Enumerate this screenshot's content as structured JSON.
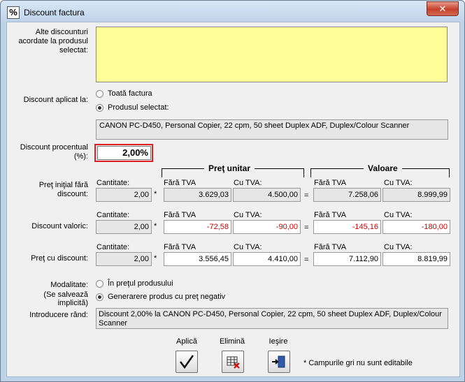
{
  "window": {
    "title": "Discount factura",
    "icon": "percent-icon"
  },
  "other_discounts": {
    "label": "Alte discounturi acordate la produsul selectat:",
    "value": ""
  },
  "apply_to": {
    "label": "Discount aplicat la:",
    "options": [
      {
        "label": "Toată factura",
        "selected": false
      },
      {
        "label": "Produsul selectat:",
        "selected": true
      }
    ],
    "product": "CANON PC-D450, Personal Copier, 22 cpm, 50 sheet Duplex ADF, Duplex/Colour Scanner"
  },
  "percent": {
    "label": "Discount procentual (%):",
    "value": "2,00%"
  },
  "headers": {
    "unit_price": "Preţ unitar",
    "value": "Valoare",
    "quantity": "Cantitate:",
    "no_vat": "Fără TVA",
    "with_vat": "Cu TVA:"
  },
  "rows": [
    {
      "label": "Preţ iniţial fără discount:",
      "quantity": "2,00",
      "unit_no_vat": "3.629,03",
      "unit_vat": "4.500,00",
      "val_no_vat": "7.258,06",
      "val_vat": "8.999,99"
    },
    {
      "label": "Discount valoric:",
      "quantity": "2,00",
      "unit_no_vat": "-72,58",
      "unit_vat": "-90,00",
      "val_no_vat": "-145,16",
      "val_vat": "-180,00"
    },
    {
      "label": "Preţ cu discount:",
      "quantity": "2,00",
      "unit_no_vat": "3.556,45",
      "unit_vat": "4.410,00",
      "val_no_vat": "7.112,90",
      "val_vat": "8.819,99"
    }
  ],
  "operators": {
    "mult": "*",
    "eq": "="
  },
  "mode": {
    "label": "Modalitate:",
    "sublabel": "(Se salvează implicită)",
    "options": [
      {
        "label": "În preţul produsului",
        "selected": false
      },
      {
        "label": "Generarere produs cu preţ negativ",
        "selected": true
      }
    ]
  },
  "row_entry": {
    "label": "Introducere rând:",
    "value": "Discount 2,00% la CANON PC-D450, Personal Copier, 22 cpm, 50 sheet Duplex ADF, Duplex/Colour Scanner"
  },
  "buttons": {
    "apply": "Aplică",
    "remove": "Elimină",
    "exit": "Ieşire"
  },
  "note": "* Campurile gri nu sunt editabile"
}
